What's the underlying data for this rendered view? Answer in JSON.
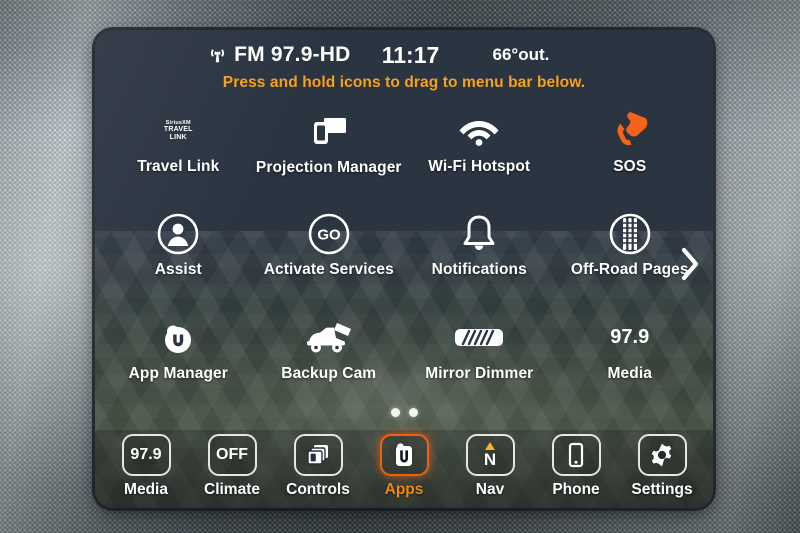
{
  "status_bar": {
    "signal_icon": "broadcast-icon",
    "source": "FM 97.9-HD",
    "clock": "11:17",
    "temperature": "66°",
    "temperature_suffix": "out."
  },
  "hint": "Press and hold icons to drag to menu bar below.",
  "apps": [
    {
      "label": "Travel Link",
      "icon": "siriusxm-travel-link-icon",
      "brand_line1": "SiriusXM",
      "brand_line2": "TRAVEL",
      "brand_line3": "LINK"
    },
    {
      "label": "Projection Manager",
      "icon": "projection-manager-icon"
    },
    {
      "label": "Wi-Fi Hotspot",
      "icon": "wifi-icon"
    },
    {
      "label": "SOS",
      "icon": "phone-handset-icon",
      "color": "#f4631a"
    },
    {
      "label": "Assist",
      "icon": "person-circle-icon"
    },
    {
      "label": "Activate Services",
      "icon": "go-circle-icon",
      "glyph": "GO"
    },
    {
      "label": "Notifications",
      "icon": "bell-icon"
    },
    {
      "label": "Off-Road Pages",
      "icon": "tire-tread-circle-icon"
    },
    {
      "label": "App Manager",
      "icon": "uconnect-app-manager-icon",
      "glyph": "U"
    },
    {
      "label": "Backup Cam",
      "icon": "truck-rear-camera-icon"
    },
    {
      "label": "Mirror Dimmer",
      "icon": "rearview-mirror-icon"
    },
    {
      "label": "Media",
      "icon": "media-frequency-icon",
      "value": "97.9"
    }
  ],
  "next_page_arrow": "chevron-right-icon",
  "page_dots": {
    "count": 2,
    "active_index": 0
  },
  "menu_bar": [
    {
      "label": "Media",
      "icon": "media-icon",
      "value": "97.9",
      "active": false
    },
    {
      "label": "Climate",
      "icon": "climate-icon",
      "value": "OFF",
      "active": false
    },
    {
      "label": "Controls",
      "icon": "controls-stack-icon",
      "active": false
    },
    {
      "label": "Apps",
      "icon": "uconnect-apps-icon",
      "value": "U",
      "active": true
    },
    {
      "label": "Nav",
      "icon": "navigation-compass-icon",
      "value": "N",
      "active": false
    },
    {
      "label": "Phone",
      "icon": "phone-device-icon",
      "active": false
    },
    {
      "label": "Settings",
      "icon": "gear-icon",
      "active": false
    }
  ],
  "colors": {
    "accent_orange": "#f0870f",
    "active_border": "#f0600f",
    "hint_orange": "#f3a11e",
    "sos_orange": "#f4631a",
    "screen_bg": "#2b3441",
    "text_white": "#ffffff"
  }
}
